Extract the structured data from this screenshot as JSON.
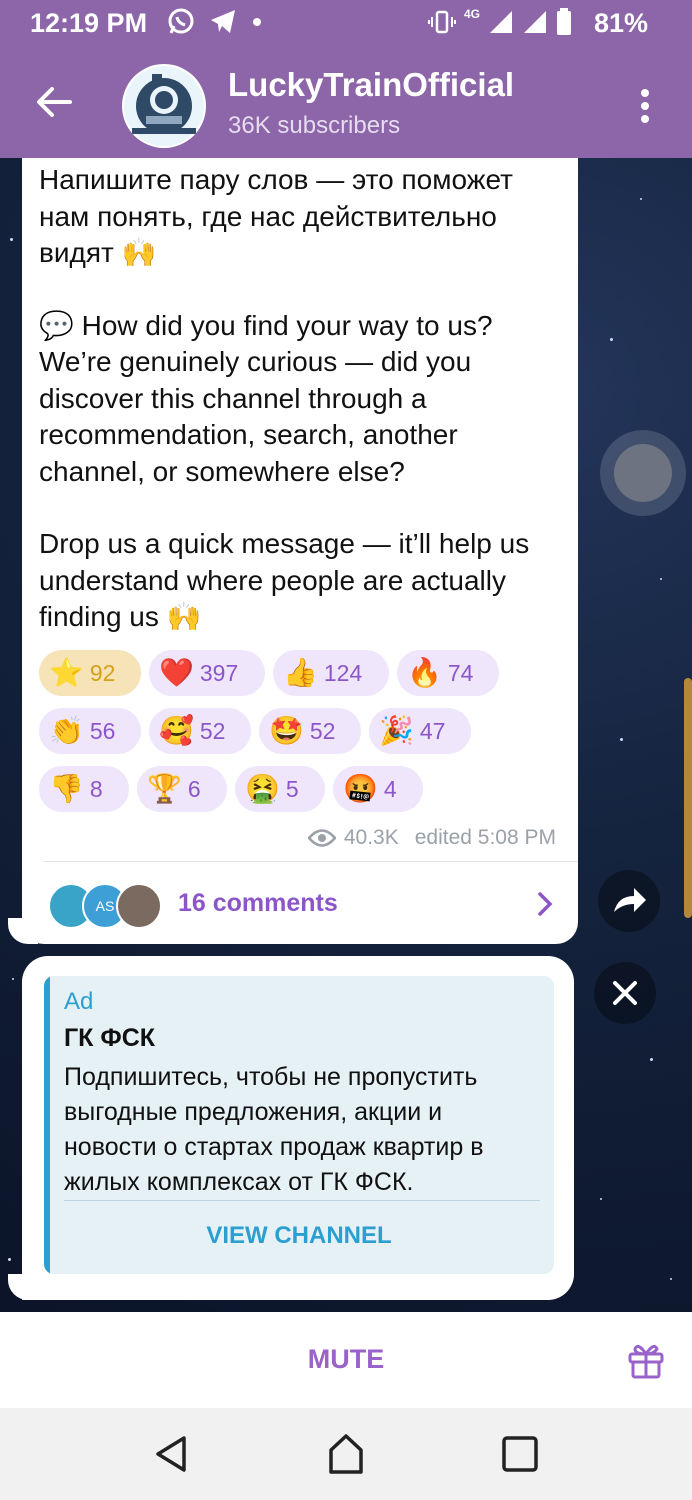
{
  "status_bar": {
    "time": "12:19 PM",
    "left_icons": [
      "whatsapp-icon",
      "telegram-icon",
      "dot-icon"
    ],
    "right_icons": [
      "vibrate-icon",
      "signal-4g-icon",
      "signal-icon",
      "battery-icon"
    ],
    "network": "4G",
    "battery": "81%"
  },
  "header": {
    "title": "LuckyTrainOfficial",
    "subtitle": "36K subscribers"
  },
  "message": {
    "ru_text": "Напишите пару слов — это поможет нам понять, где нас действительно видят 🙌",
    "en_question": "💬 How did you find your way to us? We’re genuinely curious — did you discover this channel through a recommendation, search, another channel, or somewhere else?",
    "en_cta": "Drop us a quick message — it’ll help us understand where people are actually finding us 🙌",
    "reactions": [
      {
        "emoji": "⭐",
        "count": "92",
        "active": true
      },
      {
        "emoji": "❤️",
        "count": "397"
      },
      {
        "emoji": "👍",
        "count": "124"
      },
      {
        "emoji": "🔥",
        "count": "74"
      },
      {
        "emoji": "👏",
        "count": "56"
      },
      {
        "emoji": "🥰",
        "count": "52"
      },
      {
        "emoji": "🤩",
        "count": "52"
      },
      {
        "emoji": "🎉",
        "count": "47"
      },
      {
        "emoji": "👎",
        "count": "8"
      },
      {
        "emoji": "🏆",
        "count": "6"
      },
      {
        "emoji": "🤮",
        "count": "5"
      },
      {
        "emoji": "🤬",
        "count": "4"
      }
    ],
    "views": "40.3K",
    "edited": "edited 5:08 PM",
    "comments_label": "16 comments",
    "commenter_initials": "AS"
  },
  "ad": {
    "label": "Ad",
    "title": "ГК ФСК",
    "body": "Подпишитесь, чтобы не пропустить выгодные предложения, акции и новости о стартах продаж квартир в жилых комплексах от ГК ФСК.",
    "button": "VIEW CHANNEL"
  },
  "bottom": {
    "mute": "MUTE"
  },
  "colors": {
    "header": "#8c66a8",
    "accent": "#8c56c8",
    "ad_accent": "#2b9fd0"
  }
}
